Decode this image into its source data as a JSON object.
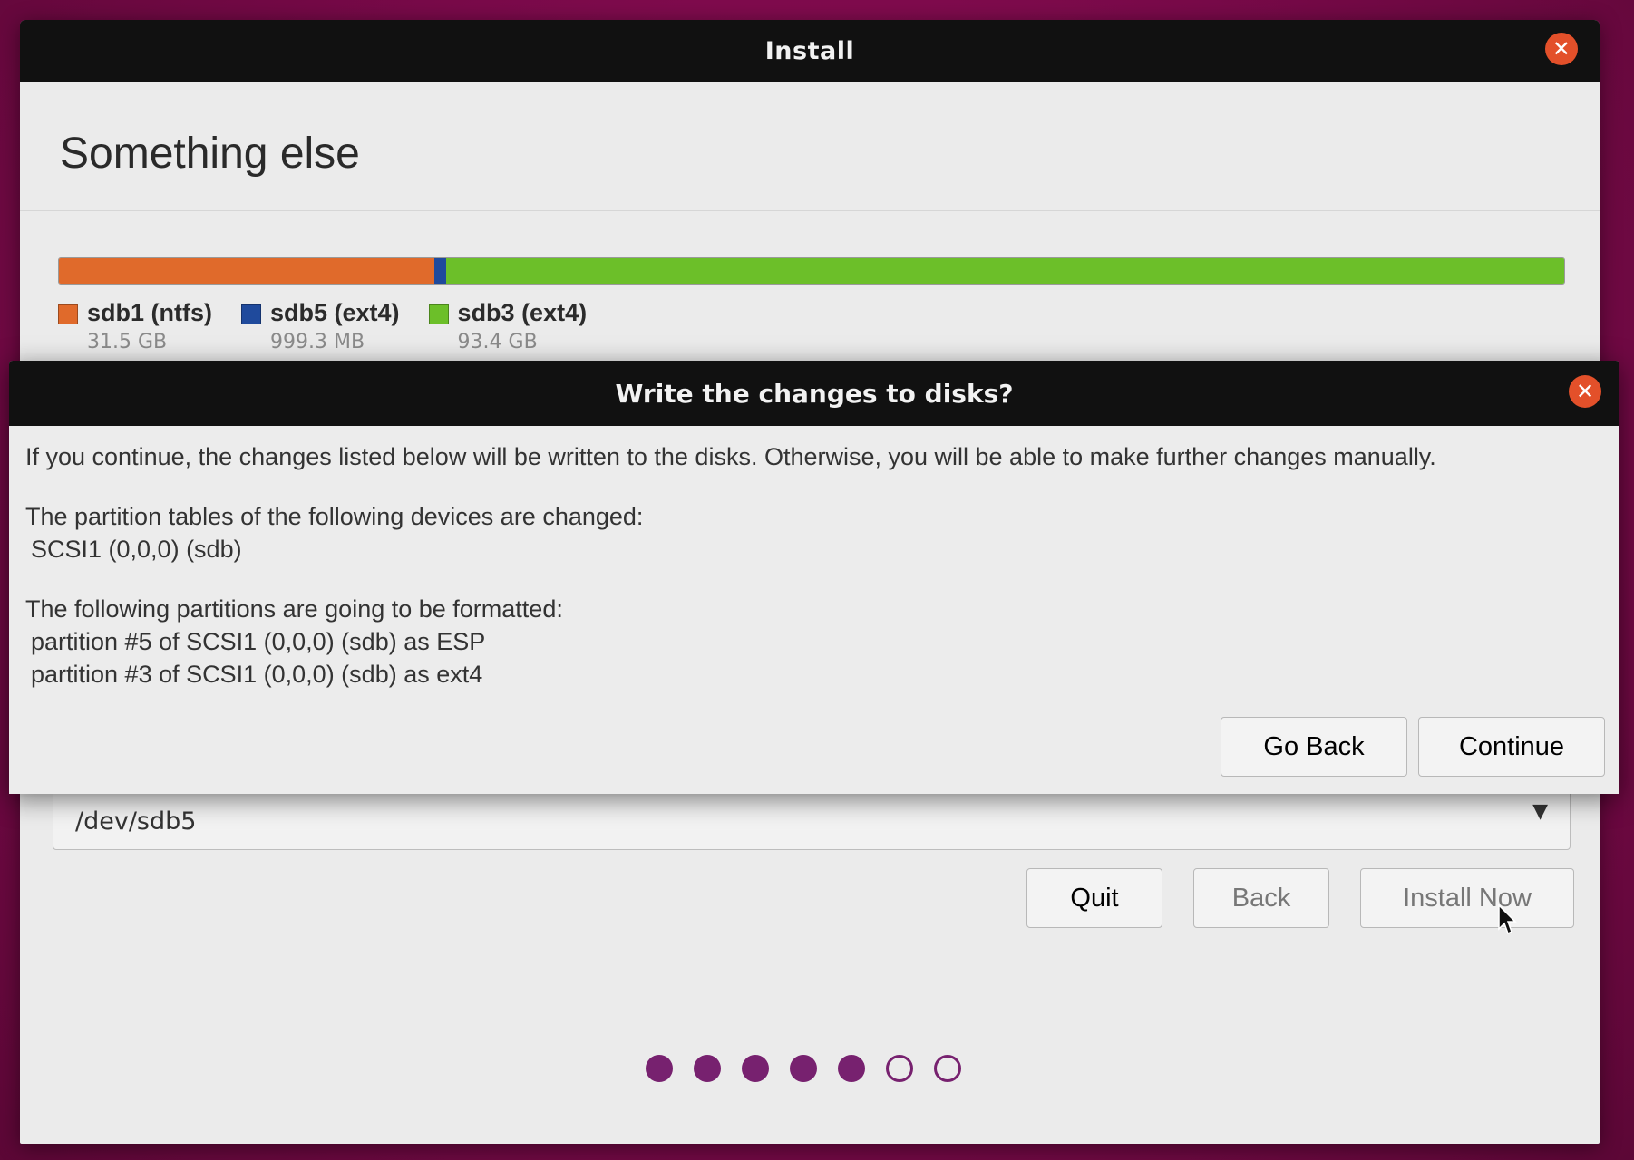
{
  "window": {
    "title": "Install"
  },
  "page": {
    "title": "Something else"
  },
  "partitions": [
    {
      "name": "sdb1 (ntfs)",
      "size": "31.5 GB",
      "color": "#e06a2b",
      "share": 0.2496
    },
    {
      "name": "sdb5 (ext4)",
      "size": "999.3 MB",
      "color": "#1f4a9c",
      "share": 0.0079
    },
    {
      "name": "sdb3 (ext4)",
      "size": "93.4 GB",
      "color": "#6cbf29",
      "share": 0.7425
    }
  ],
  "device_select": {
    "value": "/dev/sdb5"
  },
  "buttons": {
    "quit": "Quit",
    "back": "Back",
    "install_now": "Install Now"
  },
  "progress": {
    "total_steps": 7,
    "completed_steps": 5,
    "dot_color": "#77216f"
  },
  "dialog": {
    "title": "Write the changes to disks?",
    "intro": "If you continue, the changes listed below will be written to the disks. Otherwise, you will be able to make further changes manually.",
    "tables_heading": "The partition tables of the following devices are changed:",
    "tables_devices": [
      "SCSI1 (0,0,0) (sdb)"
    ],
    "format_heading": "The following partitions are going to be formatted:",
    "format_partitions": [
      "partition #5 of SCSI1 (0,0,0) (sdb) as ESP",
      "partition #3 of SCSI1 (0,0,0) (sdb) as ext4"
    ],
    "go_back_label": "Go Back",
    "continue_label": "Continue"
  },
  "icons": {
    "close": "close-icon",
    "dropdown": "chevron-down-icon",
    "cursor": "mouse-pointer-icon"
  }
}
